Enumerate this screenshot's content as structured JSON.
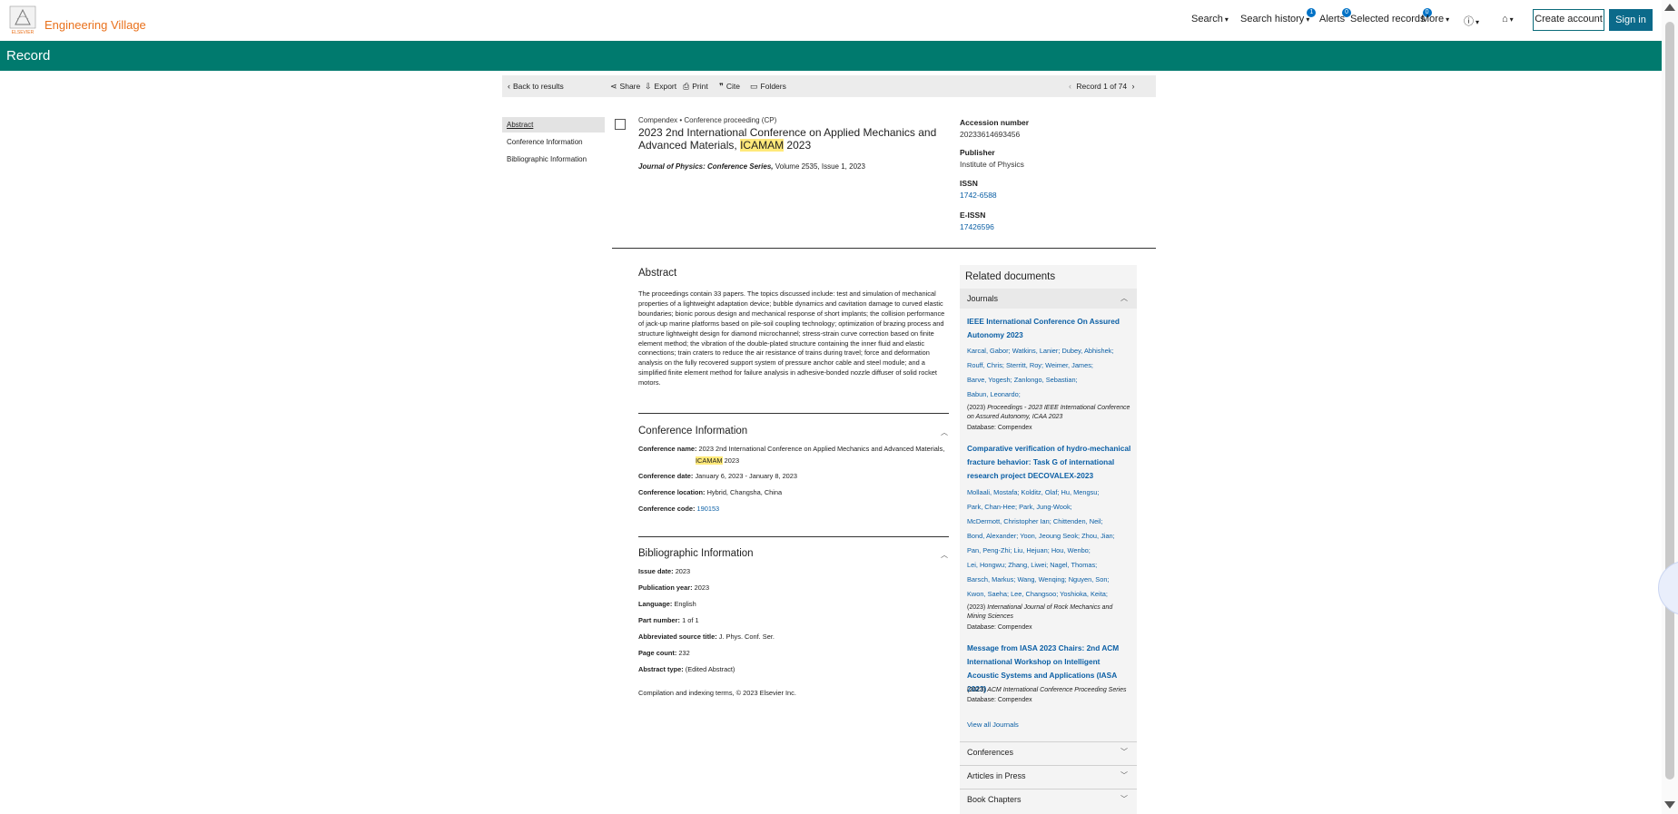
{
  "header": {
    "brand": "Engineering Village",
    "logo_text": "ELSEVIER",
    "nav": {
      "search": "Search",
      "search_history": "Search history",
      "search_history_count": "1",
      "alerts": "Alerts",
      "alerts_count": "0",
      "selected_records": "Selected records",
      "selected_records_count": "0",
      "more": "More"
    },
    "create_account": "Create account",
    "sign_in": "Sign in"
  },
  "banner": {
    "title": "Record"
  },
  "toolbar": {
    "back": "Back to results",
    "share": "Share",
    "export": "Export",
    "print": "Print",
    "cite": "Cite",
    "folders": "Folders",
    "record_position": "Record 1 of 74"
  },
  "left_nav": {
    "items": [
      "Abstract",
      "Conference Information",
      "Bibliographic Information"
    ]
  },
  "record": {
    "database": "Compendex",
    "doc_type": "Conference proceeding (CP)",
    "title_pre": "2023 2nd International Conference on Applied Mechanics and Advanced Materials,",
    "title_highlight": "ICAMAM",
    "title_post": "2023",
    "journal_name": "Journal of Physics: Conference Series,",
    "journal_details": "Volume 2535, Issue 1, 2023",
    "accession_label": "Accession number",
    "accession_value": "20233614693456",
    "publisher_label": "Publisher",
    "publisher_value": "Institute of Physics",
    "issn_label": "ISSN",
    "issn_value": "1742-6588",
    "eissn_label": "E-ISSN",
    "eissn_value": "17426596"
  },
  "abstract": {
    "heading": "Abstract",
    "text": "The proceedings contain 33 papers. The topics discussed include: test and simulation of mechanical properties of a lightweight adaptation device; bubble dynamics and cavitation damage to curved elastic boundaries; bionic porous design and mechanical response of short implants; the collision performance of jack-up marine platforms based on pile-soil coupling technology; optimization of brazing process and structure lightweight design for diamond microchannel; stress-strain curve correction based on finite element method; the vibration of the double-plated structure containing the inner fluid and elastic connections; train craters to reduce the air resistance of trains during travel; force and deformation analysis on the fully recovered support system of pressure anchor cable and steel module; and a simplified finite element method for failure analysis in adhesive-bonded nozzle diffuser of solid rocket motors."
  },
  "conference": {
    "heading": "Conference Information",
    "name_label": "Conference name:",
    "name_pre": "2023 2nd International Conference on Applied Mechanics and Advanced Materials,",
    "name_highlight": "ICAMAM",
    "name_post": "2023",
    "date_label": "Conference date:",
    "date_value": "January 6, 2023 - January 8, 2023",
    "location_label": "Conference location:",
    "location_value": "Hybrid, Changsha, China",
    "code_label": "Conference code:",
    "code_value": "190153"
  },
  "biblio": {
    "heading": "Bibliographic Information",
    "rows": [
      {
        "label": "Issue date:",
        "value": "2023"
      },
      {
        "label": "Publication year:",
        "value": "2023"
      },
      {
        "label": "Language:",
        "value": "English"
      },
      {
        "label": "Part number:",
        "value": "1 of 1"
      },
      {
        "label": "Abbreviated source title:",
        "value": "J. Phys. Conf. Ser."
      },
      {
        "label": "Page count:",
        "value": "232"
      },
      {
        "label": "Abstract type:",
        "value": "(Edited Abstract)"
      }
    ],
    "copyright": "Compilation and indexing terms, © 2023 Elsevier Inc."
  },
  "related": {
    "title": "Related documents",
    "journals_label": "Journals",
    "docs": [
      {
        "title": "IEEE International Conference On Assured Autonomy 2023",
        "authors": [
          "Karcal, Gabor; Watkins, Lanier; Dubey, Abhishek;",
          "Rouff, Chris; Sterritt, Roy; Weimer, James;",
          "Barve, Yogesh; Zanlongo, Sebastian;",
          "Babun, Leonardo;"
        ],
        "source_year": "(2023)",
        "source": "Proceedings - 2023 IEEE International Conference on Assured Autonomy, ICAA 2023",
        "database": "Database: Compendex"
      },
      {
        "title": "Comparative verification of hydro-mechanical fracture behavior: Task G of international research project DECOVALEX-2023",
        "authors": [
          "Mollaali, Mostafa; Kolditz, Olaf; Hu, Mengsu;",
          "Park, Chan-Hee; Park, Jung-Wook;",
          "McDermott, Christopher Ian; Chittenden, Neil;",
          "Bond, Alexander; Yoon, Jeoung Seok; Zhou, Jian;",
          "Pan, Peng-Zhi; Liu, Hejuan; Hou, Wenbo;",
          "Lei, Hongwu; Zhang, Liwei; Nagel, Thomas;",
          "Barsch, Markus; Wang, Wenqing; Nguyen, Son;",
          "Kwon, Saeha; Lee, Changsoo; Yoshioka, Keita;"
        ],
        "source_year": "(2023)",
        "source": "International Journal of Rock Mechanics and Mining Sciences",
        "database": "Database: Compendex"
      },
      {
        "title": "Message from IASA 2023 Chairs: 2nd ACM International Workshop on Intelligent Acoustic Systems and Applications (IASA 2023)",
        "authors": [],
        "source_year": "(2023)",
        "source": "ACM International Conference Proceeding Series",
        "database": "Database: Compendex"
      }
    ],
    "view_all": "View all Journals",
    "groups": [
      "Conferences",
      "Articles in Press",
      "Book Chapters"
    ]
  }
}
